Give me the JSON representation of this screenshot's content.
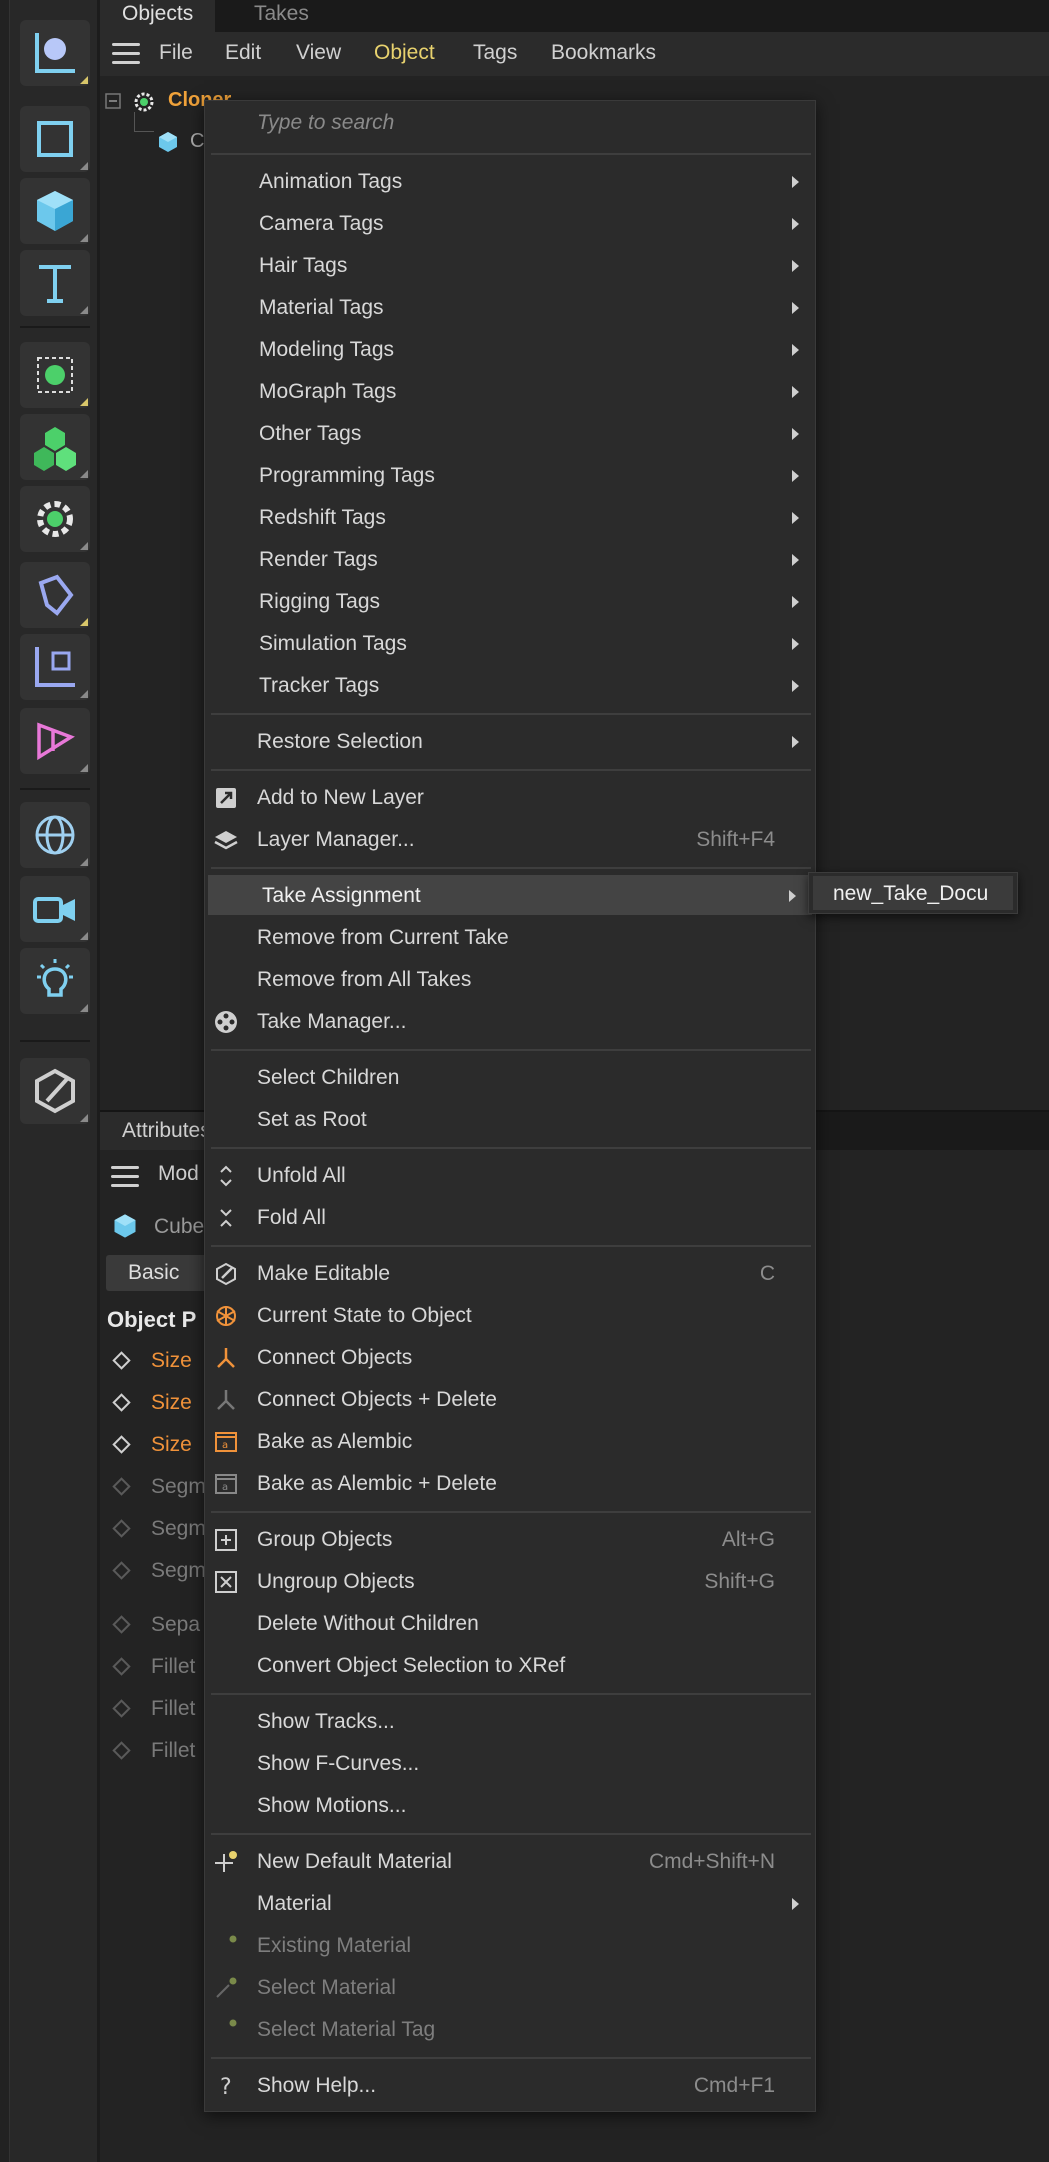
{
  "objects_panel": {
    "tabs": [
      "Objects",
      "Takes"
    ],
    "menu": [
      "File",
      "Edit",
      "View",
      "Object",
      "Tags",
      "Bookmarks"
    ],
    "active_menu": "Object",
    "tree": {
      "cloner": "Cloner",
      "child": "C"
    }
  },
  "attributes_panel": {
    "tab": "Attributes",
    "mode_label": "Mod",
    "object_name": "Cube",
    "basic_tab": "Basic",
    "section_title": "Object P",
    "params": [
      "Size",
      "Size",
      "Size",
      "Segm",
      "Segm",
      "Segm",
      "Sepa",
      "Fillet",
      "Fillet",
      "Fillet"
    ]
  },
  "context_menu": {
    "search_placeholder": "Type to search",
    "tag_items": [
      "Animation Tags",
      "Camera Tags",
      "Hair Tags",
      "Material Tags",
      "Modeling Tags",
      "MoGraph Tags",
      "Other Tags",
      "Programming Tags",
      "Redshift Tags",
      "Render Tags",
      "Rigging Tags",
      "Simulation Tags",
      "Tracker Tags"
    ],
    "restore_selection": "Restore Selection",
    "add_to_layer": "Add to New Layer",
    "layer_manager": "Layer Manager...",
    "layer_manager_shortcut": "Shift+F4",
    "take_assignment": "Take Assignment",
    "remove_current_take": "Remove from Current Take",
    "remove_all_takes": "Remove from All Takes",
    "take_manager": "Take Manager...",
    "select_children": "Select Children",
    "set_as_root": "Set as Root",
    "unfold_all": "Unfold All",
    "fold_all": "Fold All",
    "make_editable": "Make Editable",
    "make_editable_shortcut": "C",
    "current_state": "Current State to Object",
    "connect_objects": "Connect Objects",
    "connect_delete": "Connect Objects + Delete",
    "bake_alembic": "Bake as Alembic",
    "bake_alembic_delete": "Bake as Alembic + Delete",
    "group_objects": "Group Objects",
    "group_shortcut": "Alt+G",
    "ungroup_objects": "Ungroup Objects",
    "ungroup_shortcut": "Shift+G",
    "delete_without_children": "Delete Without Children",
    "convert_xref": "Convert Object Selection to XRef",
    "show_tracks": "Show Tracks...",
    "show_fcurves": "Show F-Curves...",
    "show_motions": "Show Motions...",
    "new_default_material": "New Default Material",
    "new_material_shortcut": "Cmd+Shift+N",
    "material": "Material",
    "existing_material": "Existing Material",
    "select_material": "Select Material",
    "select_material_tag": "Select Material Tag",
    "show_help": "Show Help...",
    "show_help_shortcut": "Cmd+F1"
  },
  "take_submenu": {
    "item": "new_Take_Docu"
  }
}
